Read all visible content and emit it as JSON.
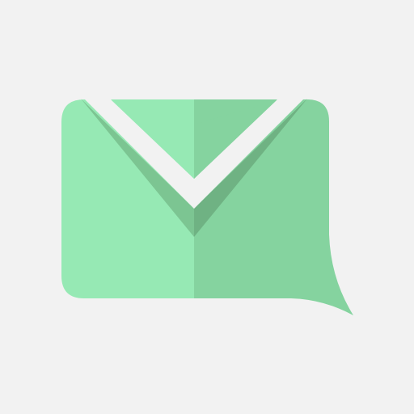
{
  "icon": {
    "name": "mail-chat-bubble-icon",
    "colors": {
      "background": "#f2f2f2",
      "bubble_light": "#96e9b4",
      "bubble_dark": "#85d39f",
      "flap_light": "#96e9b4",
      "flap_dark": "#85d39f",
      "shadow_light": "#7cc592",
      "shadow_dark": "#6fb283",
      "chevron": "#f2f2f2"
    }
  }
}
